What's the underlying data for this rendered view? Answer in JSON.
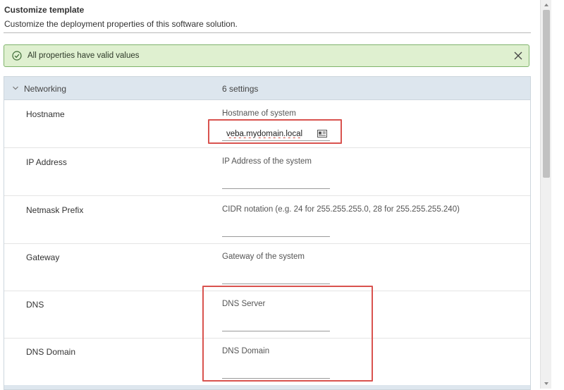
{
  "header": {
    "title": "Customize template",
    "subtitle": "Customize the deployment properties of this software solution."
  },
  "alert": {
    "message": "All properties have valid values",
    "status_color": "#dff0d0",
    "icon": "check-circle-icon",
    "close_icon": "close-icon"
  },
  "group": {
    "label": "Networking",
    "count": "6 settings",
    "expanded": true
  },
  "properties": [
    {
      "name": "Hostname",
      "description": "Hostname of system",
      "value": "veba.mydomain.local",
      "placeholder": ""
    },
    {
      "name": "IP Address",
      "description": "IP Address of the system",
      "value": "",
      "placeholder": ""
    },
    {
      "name": "Netmask Prefix",
      "description": "CIDR notation (e.g. 24 for 255.255.255.0, 28 for 255.255.255.240)",
      "value": "",
      "placeholder": ""
    },
    {
      "name": "Gateway",
      "description": "Gateway of the system",
      "value": "",
      "placeholder": ""
    },
    {
      "name": "DNS",
      "description": "DNS Server",
      "value": "",
      "placeholder": ""
    },
    {
      "name": "DNS Domain",
      "description": "DNS Domain",
      "value": "",
      "placeholder": ""
    }
  ],
  "annotation_color": "#d9534f"
}
